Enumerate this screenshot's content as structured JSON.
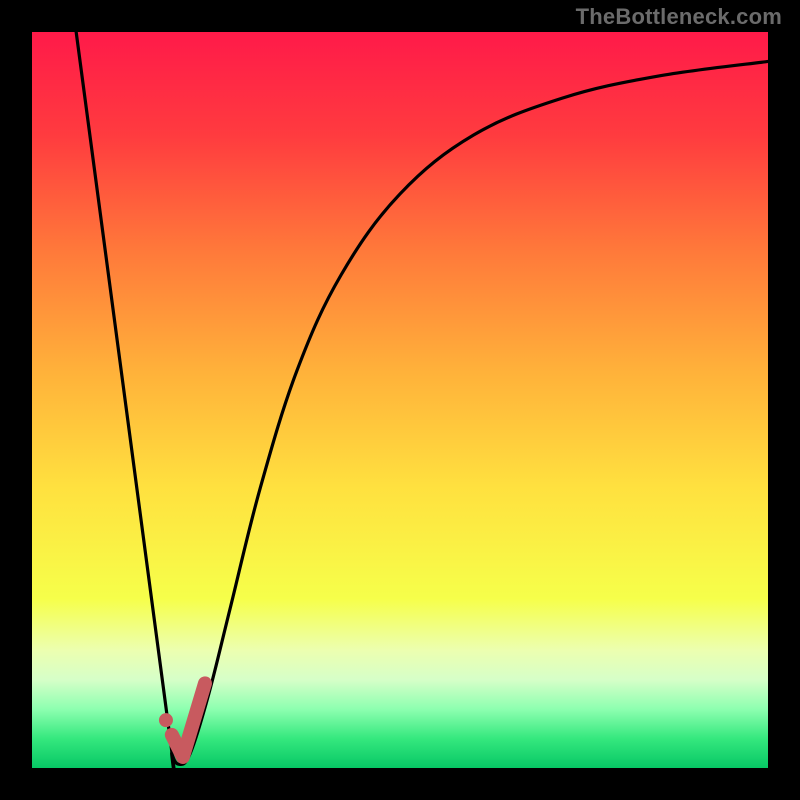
{
  "watermark": "TheBottleneck.com",
  "colors": {
    "frame": "#000000",
    "stroke_curve": "#000000",
    "marker": "#c85a5f",
    "gradient_stops": [
      {
        "pct": 0,
        "hex": "#ff1a49"
      },
      {
        "pct": 14,
        "hex": "#ff3b3f"
      },
      {
        "pct": 30,
        "hex": "#ff7a3a"
      },
      {
        "pct": 46,
        "hex": "#ffb13a"
      },
      {
        "pct": 62,
        "hex": "#ffe13f"
      },
      {
        "pct": 77,
        "hex": "#f6ff4a"
      },
      {
        "pct": 84,
        "hex": "#ecffb0"
      },
      {
        "pct": 88,
        "hex": "#d6ffc8"
      },
      {
        "pct": 92,
        "hex": "#8dffb0"
      },
      {
        "pct": 96,
        "hex": "#35e87e"
      },
      {
        "pct": 100,
        "hex": "#07c765"
      }
    ]
  },
  "chart_data": {
    "type": "line",
    "title": "",
    "xlabel": "",
    "ylabel": "",
    "x_range": [
      0,
      100
    ],
    "y_range": [
      0,
      100
    ],
    "series": [
      {
        "name": "bottleneck-curve",
        "points": [
          {
            "x": 6.0,
            "y": 100.0
          },
          {
            "x": 18.5,
            "y": 6.0
          },
          {
            "x": 19.0,
            "y": 2.0
          },
          {
            "x": 20.0,
            "y": 0.5
          },
          {
            "x": 21.5,
            "y": 2.0
          },
          {
            "x": 24.0,
            "y": 10.0
          },
          {
            "x": 27.0,
            "y": 22.0
          },
          {
            "x": 31.0,
            "y": 38.0
          },
          {
            "x": 36.0,
            "y": 54.0
          },
          {
            "x": 42.0,
            "y": 67.0
          },
          {
            "x": 50.0,
            "y": 78.0
          },
          {
            "x": 60.0,
            "y": 86.0
          },
          {
            "x": 72.0,
            "y": 91.0
          },
          {
            "x": 85.0,
            "y": 94.0
          },
          {
            "x": 100.0,
            "y": 96.0
          }
        ]
      }
    ],
    "markers": {
      "name": "optimal-region",
      "dot": {
        "x": 18.2,
        "y": 6.5
      },
      "tick_path": [
        {
          "x": 19.0,
          "y": 4.5
        },
        {
          "x": 20.5,
          "y": 1.5
        },
        {
          "x": 23.5,
          "y": 11.5
        }
      ]
    }
  }
}
